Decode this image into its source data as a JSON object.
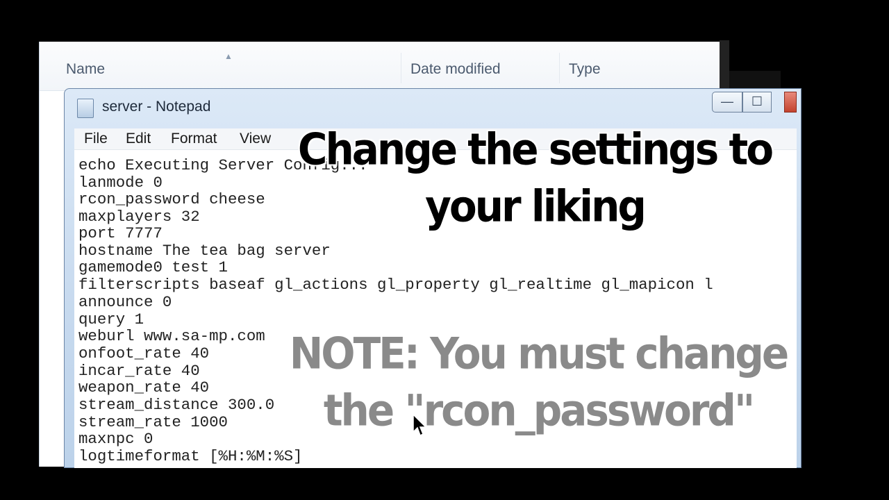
{
  "explorer": {
    "columns": [
      "Name",
      "Date modified",
      "Type"
    ]
  },
  "notepad": {
    "title": "server - Notepad",
    "controls": {
      "minimize": "—",
      "maximize": "☐",
      "close": ""
    },
    "menu": [
      "File",
      "Edit",
      "Format",
      "View"
    ],
    "lines": [
      "echo Executing Server Config...",
      "lanmode 0",
      "rcon_password cheese",
      "maxplayers 32",
      "port 7777",
      "hostname The tea bag server",
      "gamemode0 test 1",
      "filterscripts baseaf gl_actions gl_property gl_realtime gl_mapicon l",
      "announce 0",
      "query 1",
      "weburl www.sa-mp.com",
      "onfoot_rate 40",
      "incar_rate 40",
      "weapon_rate 40",
      "stream_distance 300.0",
      "stream_rate 1000",
      "maxnpc 0",
      "logtimeformat [%H:%M:%S]"
    ]
  },
  "captions": {
    "top": "Change the settings to your liking",
    "bottom": "NOTE: You must change the \"rcon_password\""
  }
}
